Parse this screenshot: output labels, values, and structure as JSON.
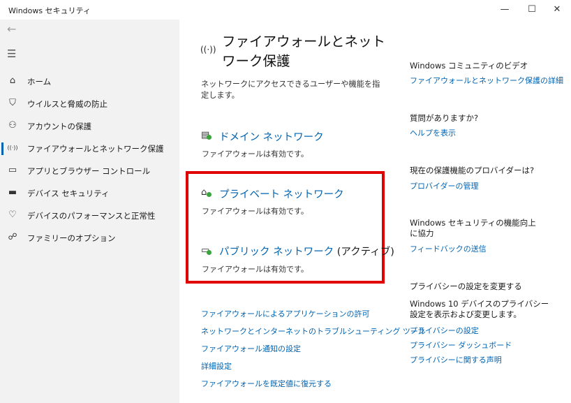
{
  "window": {
    "title": "Windows セキュリティ",
    "minimize": "—",
    "maximize": "☐",
    "close": "✕"
  },
  "sidebar": {
    "back_icon": "←",
    "menu_icon": "☰",
    "items": [
      {
        "label": "ホーム",
        "icon": "⌂"
      },
      {
        "label": "ウイルスと脅威の防止",
        "icon": "⛉"
      },
      {
        "label": "アカウントの保護",
        "icon": "⚇"
      },
      {
        "label": "ファイアウォールとネットワーク保護",
        "icon": "((·))"
      },
      {
        "label": "アプリとブラウザー コントロール",
        "icon": "▭"
      },
      {
        "label": "デバイス セキュリティ",
        "icon": "▬"
      },
      {
        "label": "デバイスのパフォーマンスと正常性",
        "icon": "♡"
      },
      {
        "label": "ファミリーのオプション",
        "icon": "☍"
      }
    ],
    "selected_index": 3
  },
  "main": {
    "header_icon": "((·))",
    "title": "ファイアウォールとネットワーク保護",
    "description": "ネットワークにアクセスできるユーザーや機能を指定します。",
    "networks": [
      {
        "title": "ドメイン ネットワーク",
        "active": "",
        "status": "ファイアウォールは有効です。",
        "icon": "▤"
      },
      {
        "title": "プライベート ネットワーク",
        "active": "",
        "status": "ファイアウォールは有効です。",
        "icon": "⌂"
      },
      {
        "title": "パブリック ネットワーク",
        "active": "(アクティブ)",
        "status": "ファイアウォールは有効です。",
        "icon": "▭"
      }
    ],
    "links": [
      "ファイアウォールによるアプリケーションの許可",
      "ネットワークとインターネットのトラブルシューティング ツール",
      "ファイアウォール通知の設定",
      "詳細設定",
      "ファイアウォールを既定値に復元する"
    ]
  },
  "right": {
    "community_heading": "Windows コミュニティのビデオ",
    "community_link": "ファイアウォールとネットワーク保護の詳細",
    "question_heading": "質問がありますか?",
    "help_link": "ヘルプを表示",
    "provider_heading": "現在の保護機能のプロバイダーは?",
    "provider_link": "プロバイダーの管理",
    "improve_heading": "Windows セキュリティの機能向上に協力",
    "feedback_link": "フィードバックの送信",
    "privacy_heading": "プライバシーの設定を変更する",
    "privacy_text": "Windows 10 デバイスのプライバシー設定を表示および変更します。",
    "privacy_links": [
      "プライバシーの設定",
      "プライバシー ダッシュボード",
      "プライバシーに関する声明"
    ]
  },
  "colors": {
    "accent": "#0063b1",
    "highlight": "#e00000",
    "sidebar_bg": "#f2f2f2",
    "status_ok": "#3aa33a"
  }
}
